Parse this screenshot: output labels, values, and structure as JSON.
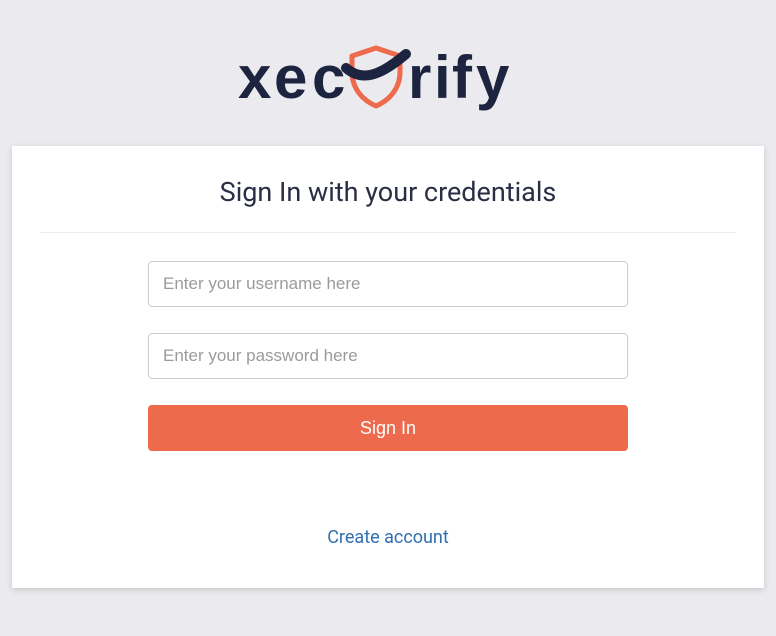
{
  "brand": {
    "name": "xecurify",
    "colors": {
      "navy": "#1c2440",
      "orange": "#ee6a4c",
      "link": "#2f6fb2"
    }
  },
  "heading": "Sign In with your credentials",
  "form": {
    "username": {
      "value": "",
      "placeholder": "Enter your username here"
    },
    "password": {
      "value": "",
      "placeholder": "Enter your password here"
    },
    "submit_label": "Sign In"
  },
  "links": {
    "create_account": "Create account"
  }
}
